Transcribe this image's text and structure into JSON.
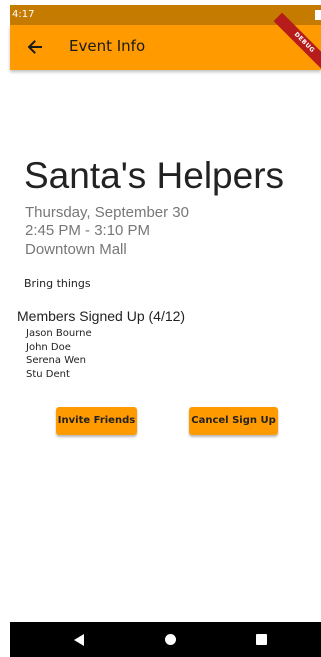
{
  "status_bar": {
    "time": "4:17"
  },
  "app_bar": {
    "title": "Event Info",
    "back_icon": "arrow-left-icon",
    "debug_banner": "DEBUG"
  },
  "event": {
    "name": "Santa's Helpers",
    "date": "Thursday, September 30",
    "time": "2:45 PM - 3:10 PM",
    "location": "Downtown Mall",
    "description": "Bring things"
  },
  "members": {
    "heading": "Members Signed Up (4/12)",
    "list": [
      "Jason Bourne",
      "John Doe",
      "Serena Wen",
      "Stu Dent"
    ]
  },
  "actions": {
    "invite_label": "Invite Friends",
    "cancel_label": "Cancel Sign Up"
  },
  "colors": {
    "accent": "#ff9a00",
    "status_bar": "#c57b00",
    "debug_banner": "#b71c1c"
  },
  "nav_bar": {
    "back_icon": "triangle-back-icon",
    "home_icon": "circle-home-icon",
    "recents_icon": "square-recents-icon"
  }
}
